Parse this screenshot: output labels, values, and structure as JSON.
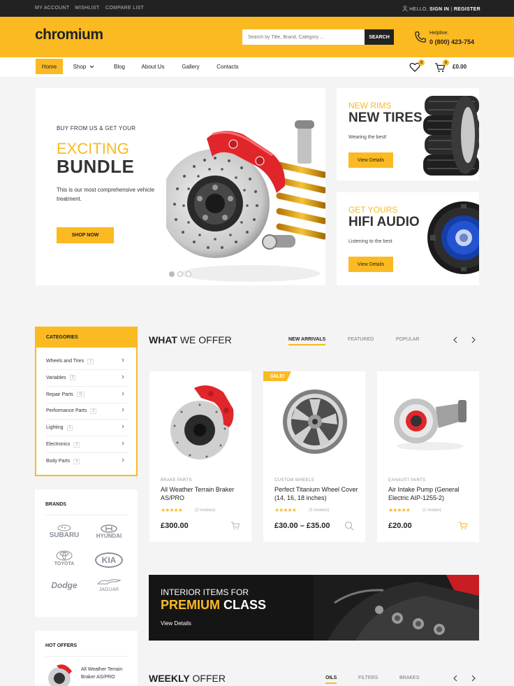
{
  "topbar": {
    "my_account": "MY ACCOUNT",
    "wishlist": "WISHLIST",
    "compare": "COMPARE LIST",
    "hello": "HELLO,",
    "sign_in": "SIGN IN",
    "sep": "|",
    "register": "REGISTER"
  },
  "header": {
    "logo": "chromium",
    "search_placeholder": "Search by Title, Brand, Category ...",
    "search_button": "SEARCH",
    "help_label": "Helpline:",
    "help_number": "0 (800) 423-754"
  },
  "nav": {
    "items": [
      "Home",
      "Shop",
      "Blog",
      "About Us",
      "Gallery",
      "Contacts"
    ],
    "wishlist_count": "0",
    "cart_count": "0",
    "cart_total": "£0.00"
  },
  "hero": {
    "subtitle": "BUY FROM US & GET YOUR",
    "title_a": "EXCITING",
    "title_b": "BUNDLE",
    "text": "This is our most comprehensive vehicle treatment.",
    "button": "SHOP NOW"
  },
  "promo_tires": {
    "kicker": "NEW RIMS",
    "title": "NEW TIRES",
    "text": "Wearing the best!",
    "button": "View Details"
  },
  "promo_audio": {
    "kicker": "GET YOURS",
    "title": "HIFI AUDIO",
    "text": "Listening to the best",
    "button": "View Details"
  },
  "categories": {
    "title": "CATEGORIES",
    "items": [
      {
        "label": "Wheels and Tires",
        "count": "2"
      },
      {
        "label": "Variables",
        "count": "3"
      },
      {
        "label": "Repair Parts",
        "count": "11"
      },
      {
        "label": "Performance Parts",
        "count": "2"
      },
      {
        "label": "Lighting",
        "count": "3"
      },
      {
        "label": "Electronics",
        "count": "3"
      },
      {
        "label": "Body Parts",
        "count": "4"
      }
    ]
  },
  "brands": {
    "title": "BRANDS",
    "items": [
      "SUBARU",
      "HYUNDAI",
      "TOYOTA",
      "KIA",
      "Dodge",
      "JAGUAR"
    ]
  },
  "hot_offers": {
    "title": "HOT OFFERS",
    "item_name": "All Weather Terrain Braker AS/PRO"
  },
  "offer": {
    "title_bold": "WHAT",
    "title_rest": " WE OFFER",
    "tabs": [
      "NEW ARRIVALS",
      "FEATURED",
      "POPULAR"
    ],
    "products": [
      {
        "category": "BRAKE PARTS",
        "name": "All Weather Terrain Braker AS/PRO",
        "reviews": "(2 reviews)",
        "price": "£300.00",
        "stars": "★★★★★",
        "sale": ""
      },
      {
        "category": "CUSTOM WHEELS",
        "name": "Perfect Titanium Wheel Cover (14, 16, 18 inches)",
        "reviews": "(3 reviews)",
        "price": "£30.00 – £35.00",
        "stars": "★★★★★",
        "sale": "SALE!"
      },
      {
        "category": "EXHAUST PARTS",
        "name": "Air Intake Pump (General Electric AIP-1255-2)",
        "reviews": "(1 review)",
        "price": "£20.00",
        "stars": "★★★★★",
        "sale": ""
      }
    ]
  },
  "banner": {
    "line1": "INTERIOR ITEMS FOR",
    "premium": "PREMIUM",
    "class": " CLASS",
    "link": "View Details"
  },
  "weekly": {
    "title_bold": "WEEKLY",
    "title_rest": " OFFER",
    "tabs": [
      "OILS",
      "FILTERS",
      "BRAKES"
    ]
  },
  "colors": {
    "accent": "#fbba21",
    "dark": "#222222",
    "background": "#f4f4f4"
  }
}
